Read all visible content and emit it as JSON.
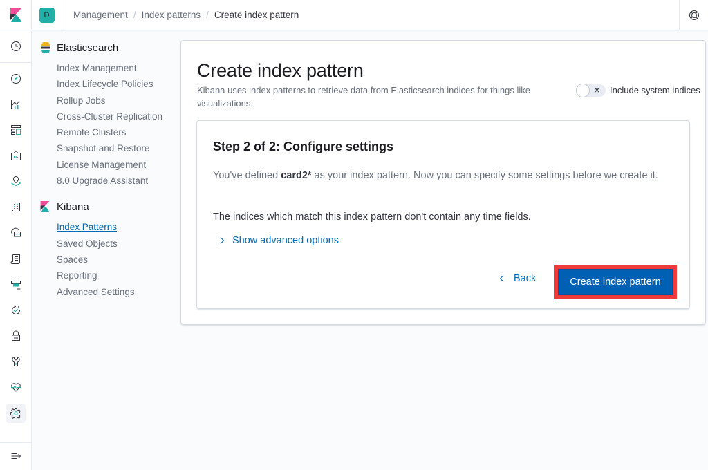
{
  "header": {
    "logo": "kibana-logo",
    "space_initial": "D",
    "breadcrumbs": [
      "Management",
      "Index patterns",
      "Create index pattern"
    ],
    "help_icon": "help-lifebuoy-icon"
  },
  "leftnav": {
    "items": [
      {
        "name": "recently-viewed",
        "icon": "clock-icon"
      },
      {
        "name": "discover",
        "icon": "compass-icon"
      },
      {
        "name": "visualize",
        "icon": "chart-icon"
      },
      {
        "name": "dashboard",
        "icon": "dashboard-icon"
      },
      {
        "name": "canvas",
        "icon": "canvas-icon"
      },
      {
        "name": "maps",
        "icon": "map-pin-icon"
      },
      {
        "name": "machine-learning",
        "icon": "ml-icon"
      },
      {
        "name": "infrastructure",
        "icon": "cloud-server-icon"
      },
      {
        "name": "logs",
        "icon": "logs-icon"
      },
      {
        "name": "apm",
        "icon": "apm-icon"
      },
      {
        "name": "uptime",
        "icon": "uptime-icon"
      },
      {
        "name": "siem",
        "icon": "lock-icon"
      },
      {
        "name": "dev-tools",
        "icon": "wrench-icon"
      },
      {
        "name": "monitoring",
        "icon": "heartbeat-icon"
      },
      {
        "name": "management",
        "icon": "gear-icon",
        "active": true
      }
    ],
    "collapse_icon": "dock-expand-icon"
  },
  "sidemenu": {
    "groups": [
      {
        "title": "Elasticsearch",
        "items": [
          "Index Management",
          "Index Lifecycle Policies",
          "Rollup Jobs",
          "Cross-Cluster Replication",
          "Remote Clusters",
          "Snapshot and Restore",
          "License Management",
          "8.0 Upgrade Assistant"
        ]
      },
      {
        "title": "Kibana",
        "items": [
          "Index Patterns",
          "Saved Objects",
          "Spaces",
          "Reporting",
          "Advanced Settings"
        ],
        "selected": "Index Patterns"
      }
    ]
  },
  "main": {
    "title": "Create index pattern",
    "description": "Kibana uses index patterns to retrieve data from Elasticsearch indices for things like visualizations.",
    "toggle": {
      "label": "Include system indices",
      "checked": false
    },
    "step": {
      "title": "Step 2 of 2: Configure settings",
      "p1_prefix": "You've defined ",
      "pattern": "card2*",
      "p1_suffix": " as your index pattern. Now you can specify some settings before we create it.",
      "p2": "The indices which match this index pattern don't contain any time fields.",
      "advanced_link": "Show advanced options",
      "back_label": "Back",
      "create_label": "Create index pattern"
    }
  },
  "colors": {
    "primary": "#006bb4",
    "create_button": "#0061b4",
    "highlight_outline": "#ef3a3a",
    "space_avatar": "#20b0a7"
  }
}
